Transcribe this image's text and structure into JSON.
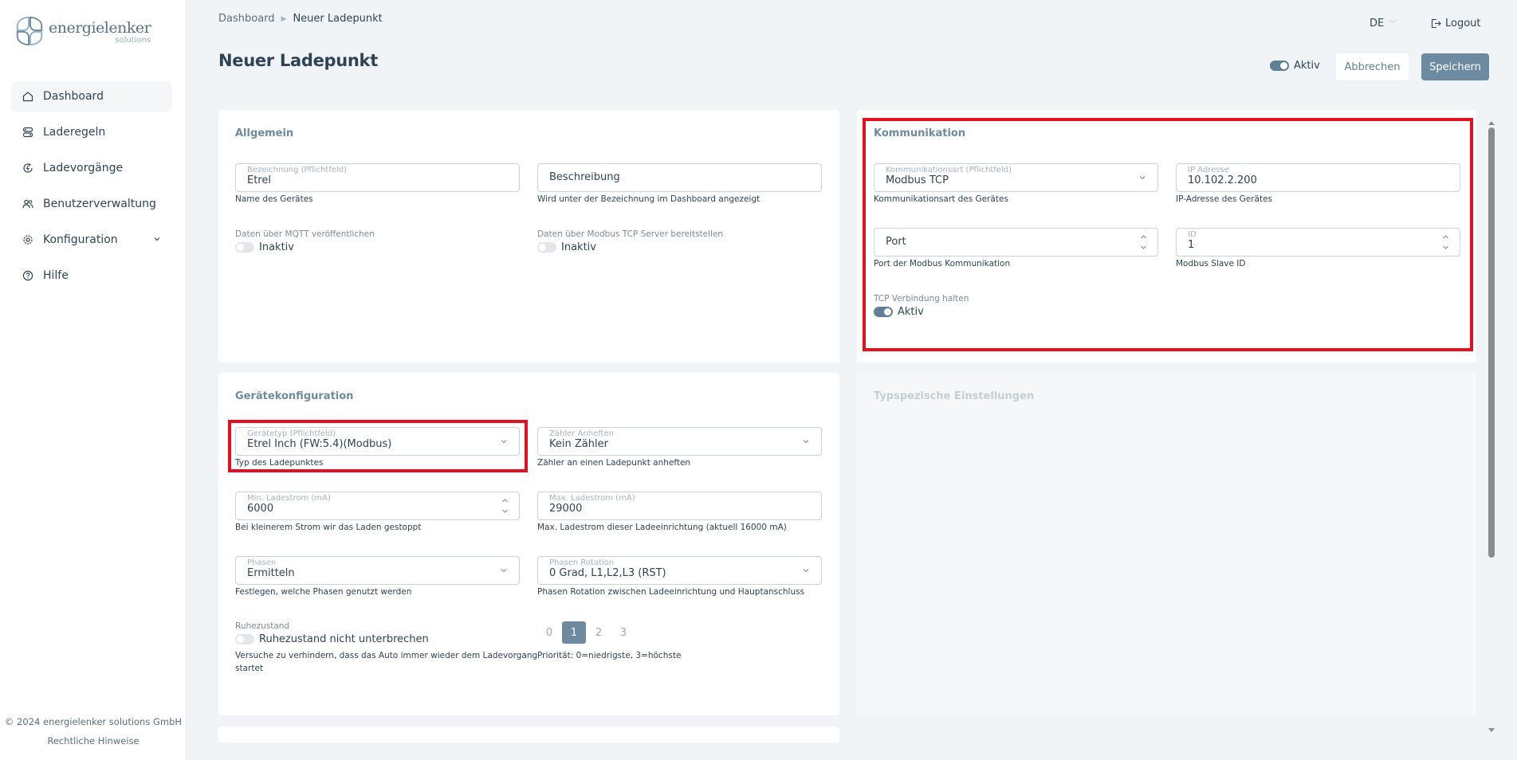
{
  "brand": {
    "name": "energielenker",
    "sub": "solutions"
  },
  "nav": [
    {
      "label": "Dashboard",
      "icon": "home-icon"
    },
    {
      "label": "Laderegeln",
      "icon": "rules-icon"
    },
    {
      "label": "Ladevorgänge",
      "icon": "charging-cycle-icon"
    },
    {
      "label": "Benutzerverwaltung",
      "icon": "users-icon"
    },
    {
      "label": "Konfiguration",
      "icon": "gear-icon"
    },
    {
      "label": "Hilfe",
      "icon": "help-icon"
    }
  ],
  "footer": {
    "copyright": "© 2024 energielenker solutions GmbH",
    "legal": "Rechtliche Hinweise"
  },
  "breadcrumb": {
    "parent": "Dashboard",
    "current": "Neuer Ladepunkt"
  },
  "header": {
    "lang": "DE",
    "logout": "Logout",
    "title": "Neuer Ladepunkt",
    "active_label": "Aktiv",
    "cancel": "Abbrechen",
    "save": "Speichern"
  },
  "allgemein": {
    "title": "Allgemein",
    "name": {
      "label": "Bezeichnung (Pflichtfeld)",
      "value": "Etrel",
      "hint": "Name des Gerätes"
    },
    "desc": {
      "placeholder": "Beschreibung",
      "hint": "Wird unter der Bezeichnung im Dashboard angezeigt"
    },
    "mqtt": {
      "label": "Daten über MQTT veröffentlichen",
      "state": "Inaktiv"
    },
    "modbus_server": {
      "label": "Daten über Modbus TCP Server bereitstellen",
      "state": "Inaktiv"
    }
  },
  "kommunikation": {
    "title": "Kommunikation",
    "art": {
      "label": "Kommunikationsart (Pflichtfeld)",
      "value": "Modbus TCP",
      "hint": "Kommunikationsart des Gerätes"
    },
    "ip": {
      "label": "IP Adresse",
      "value": "10.102.2.200",
      "hint": "IP-Adresse des Gerätes"
    },
    "port": {
      "placeholder": "Port",
      "hint": "Port der Modbus Kommunikation"
    },
    "id": {
      "label": "ID",
      "value": "1",
      "hint": "Modbus Slave ID"
    },
    "tcp": {
      "label": "TCP Verbindung halten",
      "state": "Aktiv"
    }
  },
  "geraete": {
    "title": "Gerätekonfiguration",
    "typ": {
      "label": "Gerätetyp (Pflichtfeld)",
      "value": "Etrel Inch (FW:5.4)(Modbus)",
      "hint": "Typ des Ladepunktes"
    },
    "zaehler": {
      "label": "Zähler Anheften",
      "value": "Kein Zähler",
      "hint": "Zähler an einen Ladepunkt anheften"
    },
    "min": {
      "label": "Min. Ladestrom (mA)",
      "value": "6000",
      "hint": "Bei kleinerem Strom wir das Laden gestoppt"
    },
    "max": {
      "label": "Max. Ladestrom (mA)",
      "value": "29000",
      "hint": "Max. Ladestrom dieser Ladeeinrichtung (aktuell 16000 mA)"
    },
    "phasen": {
      "label": "Phasen",
      "value": "Ermitteln",
      "hint": "Festlegen, welche Phasen genutzt werden"
    },
    "rotation": {
      "label": "Phasen Rotation",
      "value": "0 Grad, L1,L2,L3 (RST)",
      "hint": "Phasen Rotation zwischen Ladeeinrichtung und Hauptanschluss"
    },
    "ruhe": {
      "label": "Ruhezustand",
      "toggle_text": "Ruhezustand nicht unterbrechen",
      "hint1": "Versuche zu verhindern, dass das Auto immer wieder dem Ladevorgang",
      "hint2": "startet"
    },
    "prio": {
      "options": [
        "0",
        "1",
        "2",
        "3"
      ],
      "selected": "1",
      "hint": "Priorität: 0=niedrigste, 3=höchste"
    }
  },
  "typ": {
    "title": "Typspezische Einstellungen"
  },
  "colors": {
    "accent": "#6c8ba0",
    "highlight": "#e3101f",
    "background": "#f1f4f7"
  }
}
